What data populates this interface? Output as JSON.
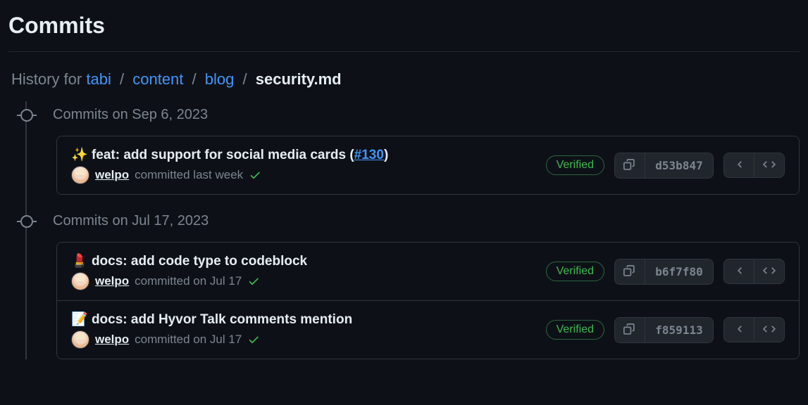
{
  "header": {
    "title": "Commits"
  },
  "breadcrumb": {
    "prefix": "History for",
    "parts": [
      "tabi",
      "content",
      "blog"
    ],
    "current": "security.md"
  },
  "verified_label": "Verified",
  "groups": [
    {
      "title": "Commits on Sep 6, 2023",
      "commits": [
        {
          "emoji": "✨",
          "title": "feat: add support for social media cards (",
          "pr": "#130",
          "title_tail": ")",
          "author": "welpo",
          "meta": "committed last week",
          "sha": "d53b847"
        }
      ]
    },
    {
      "title": "Commits on Jul 17, 2023",
      "commits": [
        {
          "emoji": "💄",
          "title": "docs: add code type to codeblock",
          "pr": "",
          "title_tail": "",
          "author": "welpo",
          "meta": "committed on Jul 17",
          "sha": "b6f7f80"
        },
        {
          "emoji": "📝",
          "title": "docs: add Hyvor Talk comments mention",
          "pr": "",
          "title_tail": "",
          "author": "welpo",
          "meta": "committed on Jul 17",
          "sha": "f859113"
        }
      ]
    }
  ]
}
